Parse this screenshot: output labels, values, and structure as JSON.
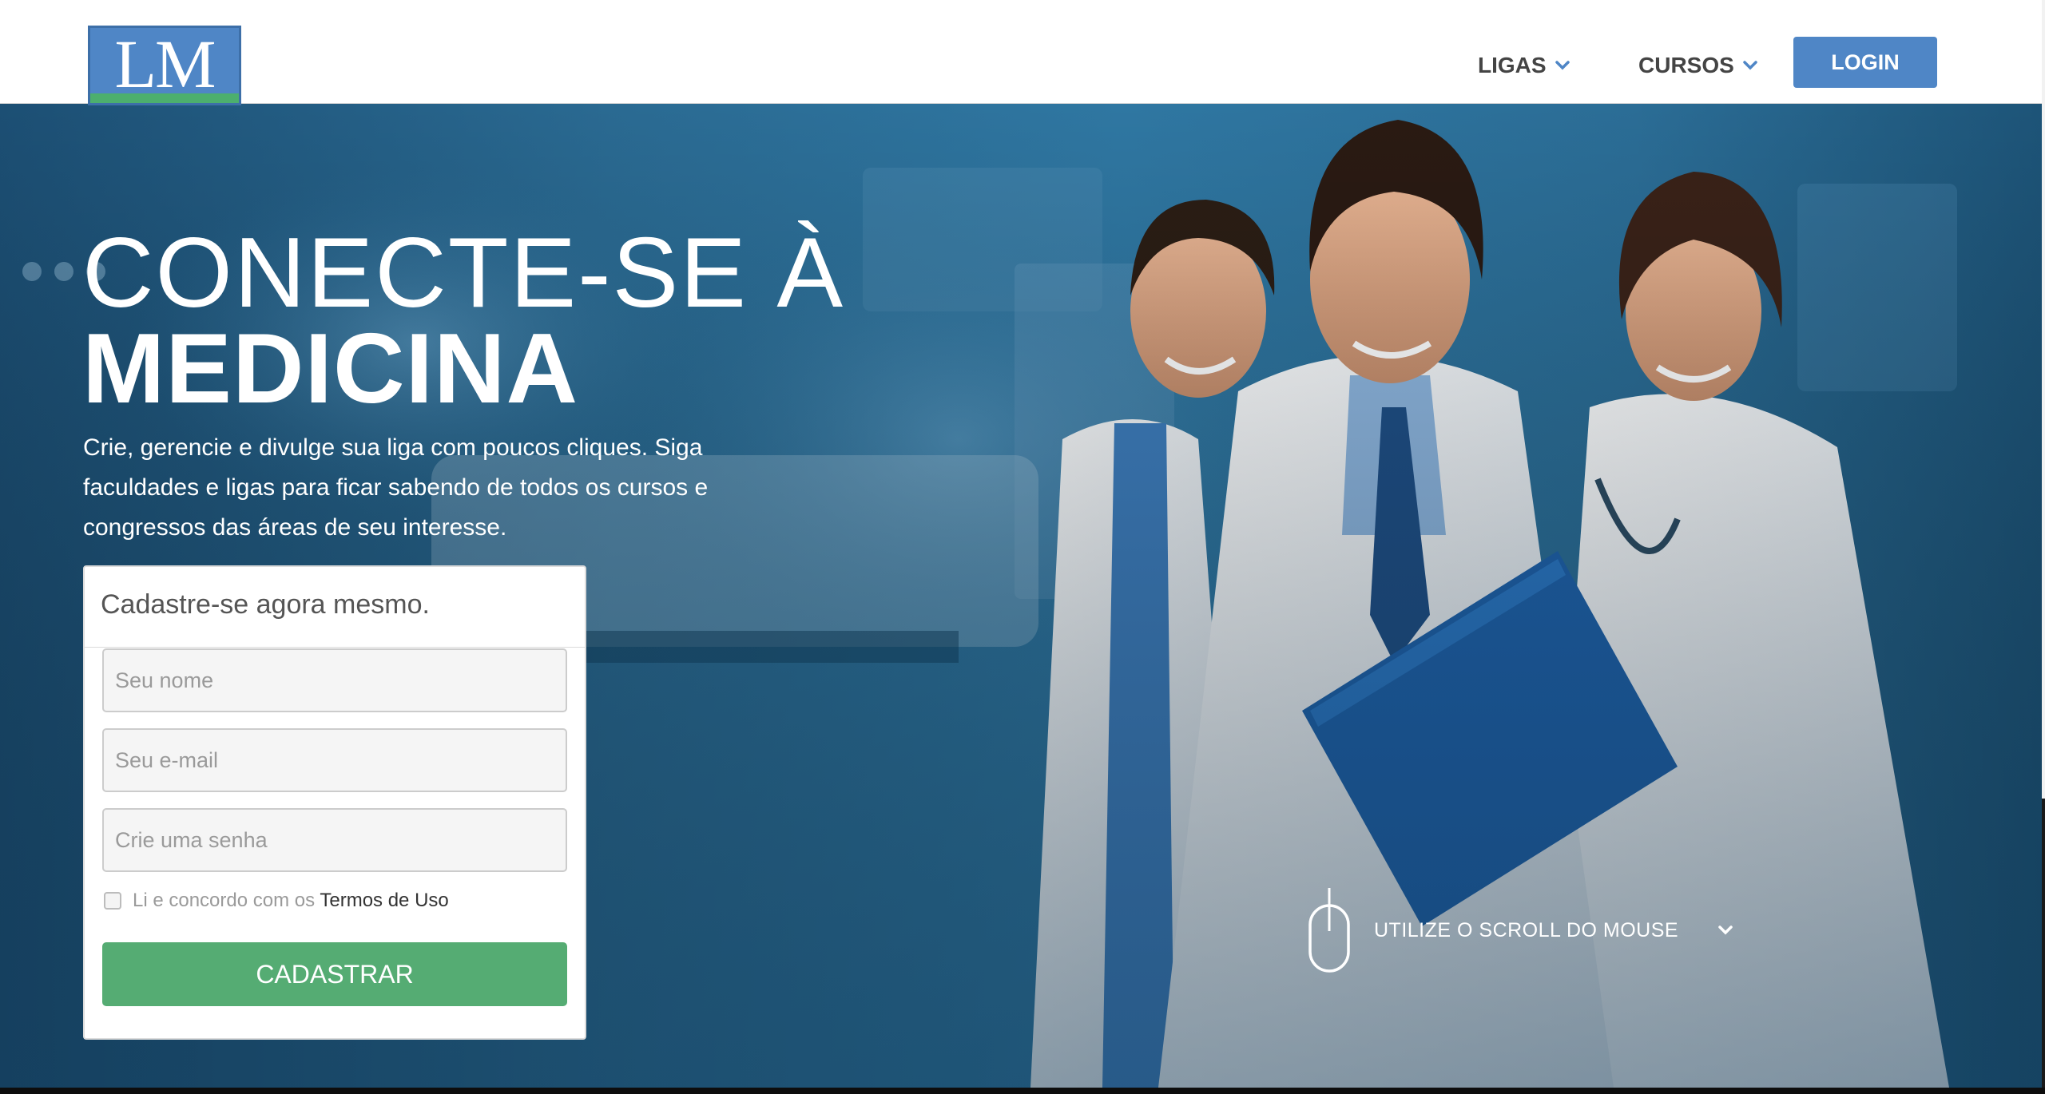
{
  "header": {
    "logo_text": "LM",
    "nav": [
      {
        "label": "LIGAS",
        "icon": "chevron-down-icon"
      },
      {
        "label": "CURSOS",
        "icon": "chevron-down-icon"
      }
    ],
    "login_label": "LOGIN"
  },
  "hero": {
    "headline_light": "CONECTE-SE À",
    "headline_bold": "MEDICINA",
    "description": "Crie, gerencie e divulge sua liga com poucos cliques. Siga faculdades e ligas para ficar sabendo de todos os cursos e congressos das áreas de seu interesse."
  },
  "signup": {
    "title": "Cadastre-se agora mesmo.",
    "name_placeholder": "Seu nome",
    "email_placeholder": "Seu e-mail",
    "password_placeholder": "Crie uma senha",
    "terms_prefix": "Li e concordo com os",
    "terms_link": "Termos de Uso",
    "submit_label": "CADASTRAR"
  },
  "scroll_hint": {
    "text": "UTILIZE O SCROLL DO MOUSE",
    "icon": "mouse-icon"
  },
  "colors": {
    "brand_blue": "#4f86c6",
    "brand_green": "#55ac73",
    "nav_text": "#444444",
    "hero_blue": "#2b6d96"
  }
}
